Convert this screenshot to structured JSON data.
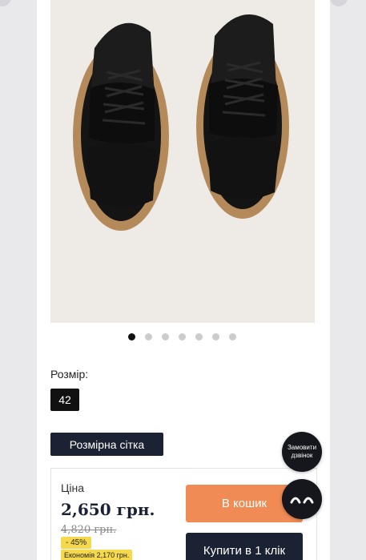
{
  "gallery": {
    "slides_total": 7,
    "active_slide": 1,
    "image_subject": "black sneakers on a tan sole"
  },
  "size": {
    "label": "Розмір:",
    "selected": "42"
  },
  "size_chart_button": "Розмірна сітка",
  "pricing": {
    "label": "Ціна",
    "price": "2,650 грн.",
    "old_price": "4,820 грн.",
    "discount": "- 45%",
    "saving": "Економія 2,170 грн."
  },
  "actions": {
    "cart_label": "В кошик",
    "buy_one_click_label": "Купити в 1 клік"
  },
  "floating": {
    "callback_label_line1": "Замовити",
    "callback_label_line2": "дзвінок",
    "chat_icon": "chat-eyes-icon"
  },
  "colors": {
    "cart_button": "#f08b55",
    "dark_button": "#1b2233",
    "badge": "#f6d84c",
    "photo_background": "#eeeae6"
  }
}
